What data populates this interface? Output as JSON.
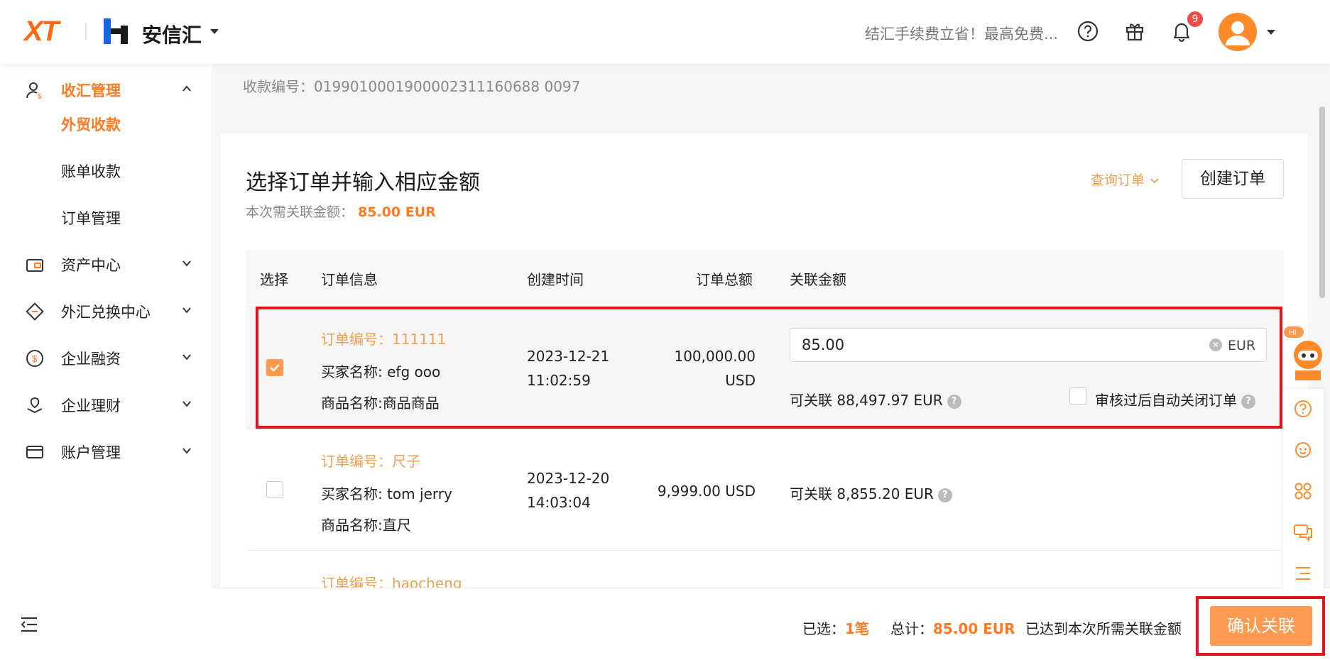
{
  "header": {
    "logo": "XT",
    "brand": "安信汇",
    "promo": "结汇手续费立省！最高免费...",
    "notification_count": "9"
  },
  "sidebar": {
    "items": [
      {
        "label": "收汇管理",
        "icon": "receive-money-icon",
        "expanded": true
      },
      {
        "label": "资产中心",
        "icon": "wallet-icon"
      },
      {
        "label": "外汇兑换中心",
        "icon": "exchange-icon"
      },
      {
        "label": "企业融资",
        "icon": "finance-icon"
      },
      {
        "label": "企业理财",
        "icon": "wealth-icon"
      },
      {
        "label": "账户管理",
        "icon": "account-card-icon"
      }
    ],
    "sub_items": [
      {
        "label": "外贸收款",
        "active": true
      },
      {
        "label": "账单收款"
      },
      {
        "label": "订单管理"
      }
    ]
  },
  "main": {
    "receipt_no": "收款编号：0199010001900002311160688 0097",
    "title": "选择订单并输入相应金额",
    "need_label": "本次需关联金额：",
    "need_amount": "85.00 EUR",
    "query_link": "查询订单",
    "create_button": "创建订单",
    "table": {
      "headers": [
        "选择",
        "订单信息",
        "创建时间",
        "订单总额",
        "关联金额"
      ],
      "rows": [
        {
          "selected": true,
          "order_no": "订单编号：111111",
          "buyer": "买家名称: efg ooo",
          "product": "商品名称:商品商品",
          "date": "2023-12-21",
          "time": "11:02:59",
          "total_line1": "100,000.00",
          "total_line2": "USD",
          "amount_value": "85.00",
          "currency": "EUR",
          "available": "可关联 88,497.97 EUR",
          "auto_close": "审核过后自动关闭订单"
        },
        {
          "selected": false,
          "order_no": "订单编号：尺子",
          "buyer": "买家名称: tom jerry",
          "product": "商品名称:直尺",
          "date": "2023-12-20",
          "time": "14:03:04",
          "total": "9,999.00 USD",
          "available": "可关联 8,855.20 EUR"
        },
        {
          "order_no": "订单编号：haocheng"
        }
      ]
    }
  },
  "footer": {
    "selected_label": "已选：",
    "selected_count": "1笔",
    "total_label": "总计：",
    "total_amount": "85.00 EUR",
    "reached": "已达到本次所需关联金额",
    "confirm_button": "确认关联"
  },
  "assistant": {
    "hi": "Hi"
  },
  "colors": {
    "accent": "#ff7a20",
    "accent_light": "#ff9a50",
    "highlight": "#e0141e"
  }
}
